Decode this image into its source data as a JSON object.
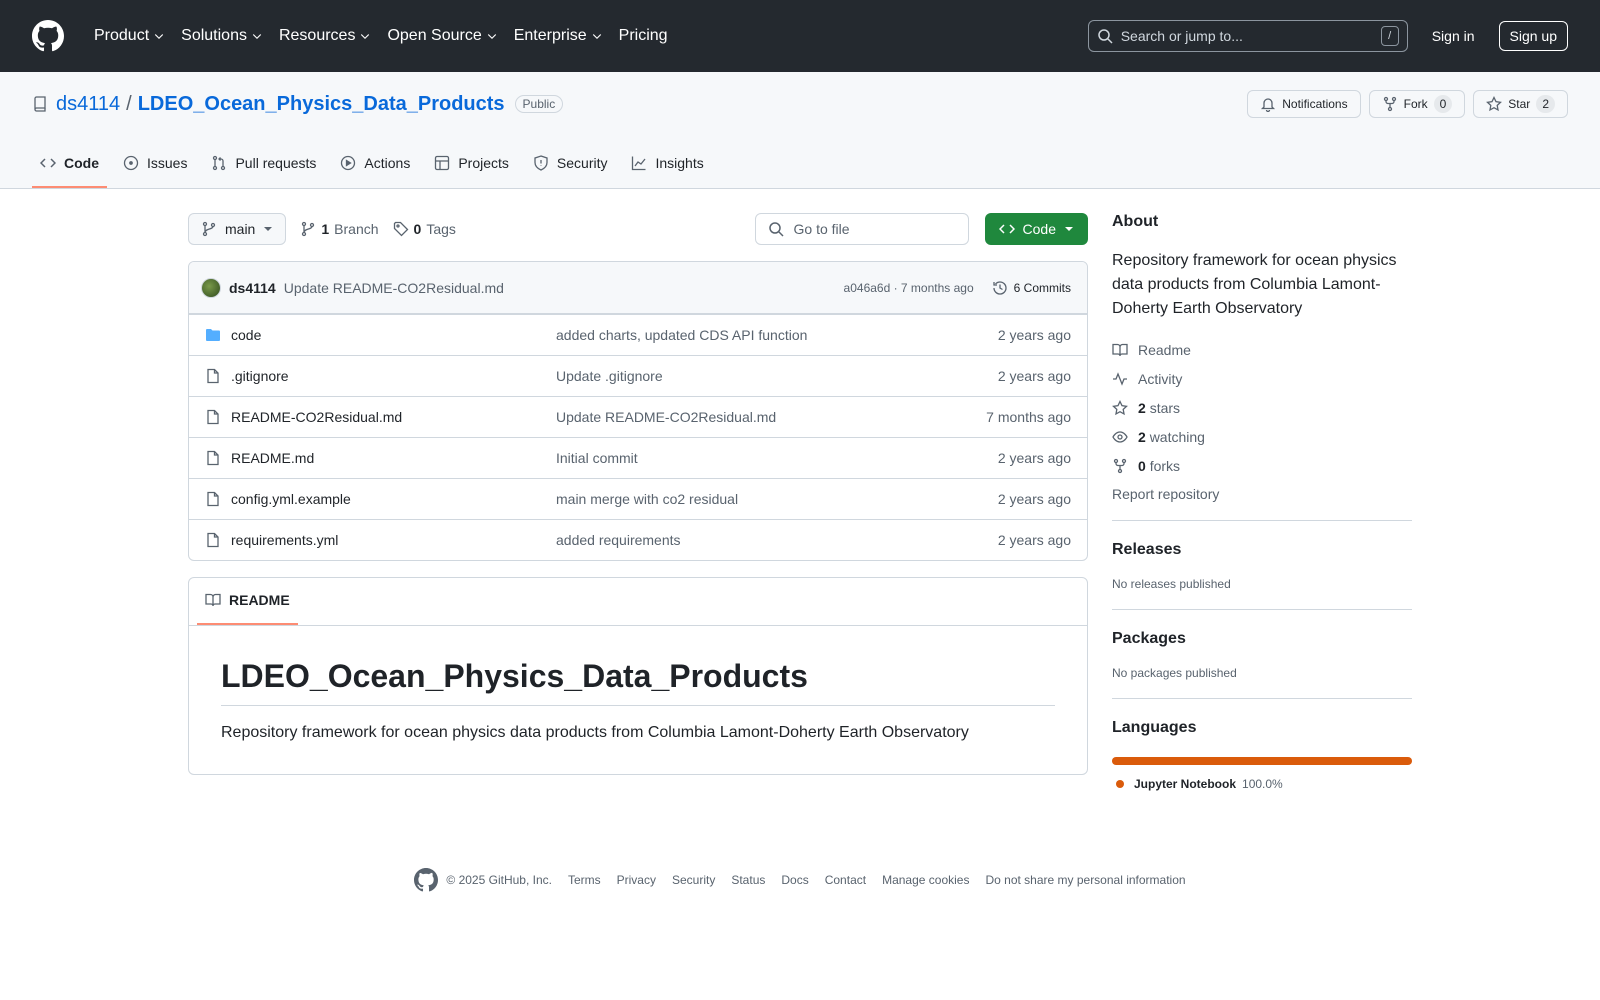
{
  "header": {
    "nav": [
      {
        "label": "Product",
        "dropdown": true
      },
      {
        "label": "Solutions",
        "dropdown": true
      },
      {
        "label": "Resources",
        "dropdown": true
      },
      {
        "label": "Open Source",
        "dropdown": true
      },
      {
        "label": "Enterprise",
        "dropdown": true
      },
      {
        "label": "Pricing",
        "dropdown": false
      }
    ],
    "search_placeholder": "Search or jump to...",
    "search_key": "/",
    "signin": "Sign in",
    "signup": "Sign up"
  },
  "repo": {
    "owner": "ds4114",
    "separator": "/",
    "name": "LDEO_Ocean_Physics_Data_Products",
    "visibility": "Public",
    "notifications_label": "Notifications",
    "fork_label": "Fork",
    "fork_count": "0",
    "star_label": "Star",
    "star_count": "2"
  },
  "tabs": [
    {
      "label": "Code",
      "icon": "code-icon",
      "active": true
    },
    {
      "label": "Issues",
      "icon": "issue-icon"
    },
    {
      "label": "Pull requests",
      "icon": "pull-request-icon"
    },
    {
      "label": "Actions",
      "icon": "play-icon"
    },
    {
      "label": "Projects",
      "icon": "table-icon"
    },
    {
      "label": "Security",
      "icon": "shield-icon"
    },
    {
      "label": "Insights",
      "icon": "graph-icon"
    }
  ],
  "toolbar": {
    "branch": "main",
    "branch_count": "1",
    "branch_label": "Branch",
    "tag_count": "0",
    "tag_label": "Tags",
    "goto_placeholder": "Go to file",
    "code_button": "Code"
  },
  "latest_commit": {
    "author": "ds4114",
    "message": "Update README-CO2Residual.md",
    "hash_time": "a046a6d · 7 months ago",
    "commits_label": "6 Commits"
  },
  "files": [
    {
      "name": "code",
      "type": "folder",
      "message": "added charts, updated CDS API function",
      "time": "2 years ago"
    },
    {
      "name": ".gitignore",
      "type": "file",
      "message": "Update .gitignore",
      "time": "2 years ago"
    },
    {
      "name": "README-CO2Residual.md",
      "type": "file",
      "message": "Update README-CO2Residual.md",
      "time": "7 months ago"
    },
    {
      "name": "README.md",
      "type": "file",
      "message": "Initial commit",
      "time": "2 years ago"
    },
    {
      "name": "config.yml.example",
      "type": "file",
      "message": "main merge with co2 residual",
      "time": "2 years ago"
    },
    {
      "name": "requirements.yml",
      "type": "file",
      "message": "added requirements",
      "time": "2 years ago"
    }
  ],
  "readme": {
    "tab_label": "README",
    "title": "LDEO_Ocean_Physics_Data_Products",
    "body": "Repository framework for ocean physics data products from Columbia Lamont-Doherty Earth Observatory"
  },
  "about": {
    "heading": "About",
    "description": "Repository framework for ocean physics data products from Columbia Lamont-Doherty Earth Observatory",
    "readme_label": "Readme",
    "activity_label": "Activity",
    "stars_count": "2",
    "stars_label": "stars",
    "watching_count": "2",
    "watching_label": "watching",
    "forks_count": "0",
    "forks_label": "forks",
    "report_label": "Report repository"
  },
  "releases": {
    "heading": "Releases",
    "empty": "No releases published"
  },
  "packages": {
    "heading": "Packages",
    "empty": "No packages published"
  },
  "languages": {
    "heading": "Languages",
    "items": [
      {
        "name": "Jupyter Notebook",
        "percent": "100.0%",
        "color": "#da5b0b"
      }
    ]
  },
  "footer": {
    "copyright": "© 2025 GitHub, Inc.",
    "links": [
      "Terms",
      "Privacy",
      "Security",
      "Status",
      "Docs",
      "Contact",
      "Manage cookies",
      "Do not share my personal information"
    ]
  },
  "colors": {
    "header_bg": "#24292f",
    "link": "#0969da",
    "primary_button": "#1f883d",
    "tab_underline": "#fd8c73",
    "folder": "#54aeff",
    "language": "#da5b0b"
  }
}
